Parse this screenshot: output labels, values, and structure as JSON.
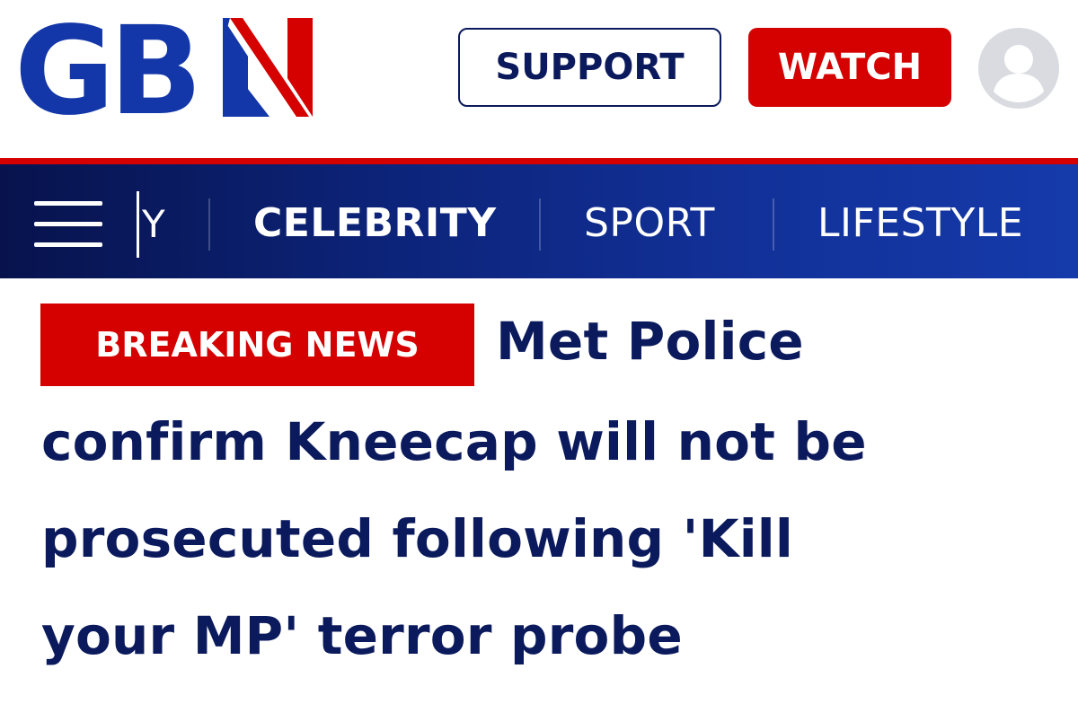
{
  "brand": {
    "logo_text": "GBN",
    "colors": {
      "navy": "#0b1a5c",
      "red": "#d50000",
      "nav_blue": "#123199"
    }
  },
  "header": {
    "support_label": "SUPPORT",
    "watch_label": "WATCH",
    "avatar_icon": "user-avatar-icon"
  },
  "nav": {
    "menu_icon": "hamburger-icon",
    "clipped_item": "Y",
    "items": [
      {
        "label": "CELEBRITY",
        "active": true
      },
      {
        "label": "SPORT",
        "active": false
      },
      {
        "label": "LIFESTYLE",
        "active": false
      }
    ]
  },
  "article": {
    "badge": "BREAKING NEWS",
    "headline_lines": [
      "Met Police",
      "confirm Kneecap will not be",
      "prosecuted following 'Kill",
      "your MP' terror probe"
    ]
  }
}
